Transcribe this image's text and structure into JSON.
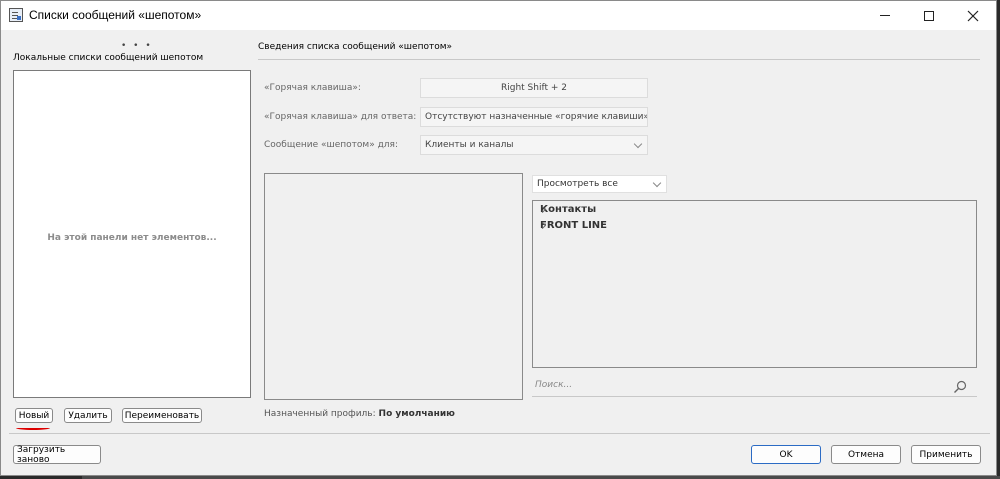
{
  "window": {
    "title": "Списки сообщений «шепотом»",
    "icon": "whisper-list-app-icon"
  },
  "left_panel": {
    "dots": "• • •",
    "label": "Локальные списки сообщений шепотом",
    "empty_text": "На этой панели нет элементов...",
    "buttons": {
      "new": "Новый",
      "delete": "Удалить",
      "rename": "Переименовать"
    }
  },
  "details": {
    "title": "Сведения списка сообщений «шепотом»",
    "hotkey_label": "«Горячая клавиша»:",
    "hotkey_value": "Right Shift + 2",
    "reply_hotkey_label": "«Горячая клавиша» для ответа:",
    "reply_hotkey_value": "Отсутствуют назначенные «горячие клавиши»",
    "whisper_for_label": "Сообщение «шепотом» для:",
    "whisper_for_value": "Клиенты и каналы",
    "view_select": "Просмотреть все",
    "tree": [
      {
        "label": "Контакты"
      },
      {
        "label": "FRONT LINE"
      }
    ],
    "search_placeholder": "Поиск...",
    "profile_label": "Назначенный профиль:",
    "profile_value": "По умолчанию"
  },
  "footer": {
    "reload": "Загрузить заново",
    "ok": "OK",
    "cancel": "Отмена",
    "apply": "Применить"
  },
  "colors": {
    "window_bg": "#f0f0f0",
    "accent": "#2b6bc4",
    "annotation": "#dd0000"
  }
}
